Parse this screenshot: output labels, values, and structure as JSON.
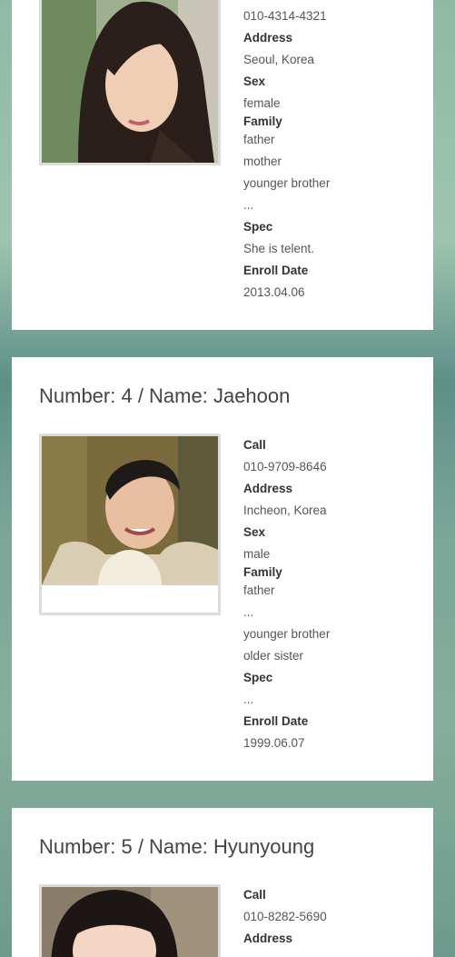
{
  "cards": [
    {
      "title": "",
      "photo_alt": "woman-portrait",
      "rows": [
        {
          "type": "value",
          "text": "010-4314-4321"
        },
        {
          "type": "label",
          "text": "Address"
        },
        {
          "type": "value",
          "text": "Seoul, Korea"
        },
        {
          "type": "label",
          "text": "Sex"
        },
        {
          "type": "value",
          "text": "female"
        },
        {
          "type": "label",
          "text": "Family"
        },
        {
          "type": "value",
          "text": "father"
        },
        {
          "type": "value",
          "text": "mother"
        },
        {
          "type": "value",
          "text": "younger brother"
        },
        {
          "type": "value",
          "text": "..."
        },
        {
          "type": "label",
          "text": "Spec"
        },
        {
          "type": "value",
          "text": "She is telent."
        },
        {
          "type": "label",
          "text": "Enroll Date"
        },
        {
          "type": "value",
          "text": "2013.04.06"
        }
      ]
    },
    {
      "title": "Number: 4 / Name: Jaehoon",
      "photo_alt": "man-portrait",
      "rows": [
        {
          "type": "label",
          "text": "Call"
        },
        {
          "type": "value",
          "text": "010-9709-8646"
        },
        {
          "type": "label",
          "text": "Address"
        },
        {
          "type": "value",
          "text": "Incheon, Korea"
        },
        {
          "type": "label",
          "text": "Sex"
        },
        {
          "type": "value",
          "text": "male"
        },
        {
          "type": "label",
          "text": "Family"
        },
        {
          "type": "value",
          "text": "father"
        },
        {
          "type": "value",
          "text": "..."
        },
        {
          "type": "value",
          "text": "younger brother"
        },
        {
          "type": "value",
          "text": "older sister"
        },
        {
          "type": "label",
          "text": "Spec"
        },
        {
          "type": "value",
          "text": "..."
        },
        {
          "type": "label",
          "text": "Enroll Date"
        },
        {
          "type": "value",
          "text": "1999.06.07"
        }
      ]
    },
    {
      "title": "Number: 5 / Name: Hyunyoung",
      "photo_alt": "girl-portrait",
      "rows": [
        {
          "type": "label",
          "text": "Call"
        },
        {
          "type": "value",
          "text": "010-8282-5690"
        },
        {
          "type": "label",
          "text": "Address"
        }
      ]
    }
  ]
}
